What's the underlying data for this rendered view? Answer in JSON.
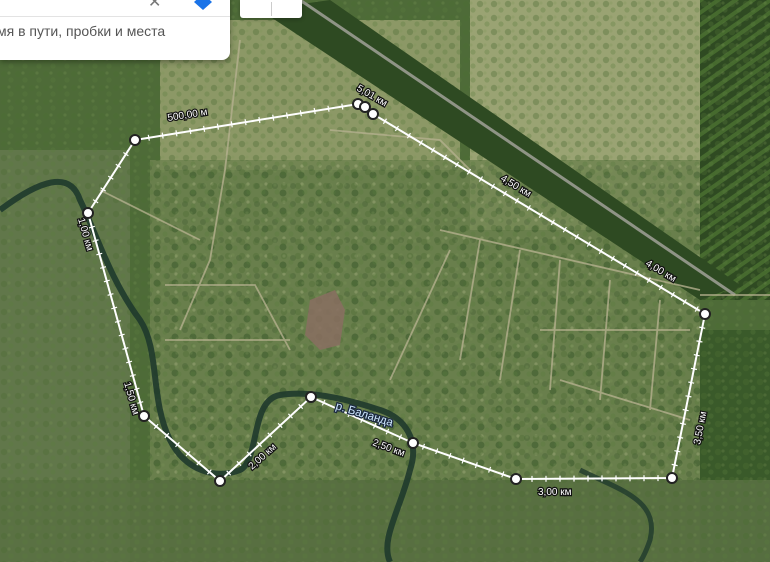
{
  "search_panel": {
    "clear_symbol": "✕",
    "traffic_text": "мя в пути, пробки и места"
  },
  "map": {
    "river_label": "р. Баланда",
    "measurement": {
      "line_color": "#ffffff",
      "segment_labels": [
        "500,00 м",
        "5,01 км",
        "4,50 км",
        "4,00 км",
        "3,50 км",
        "3,00 км",
        "2,50 км",
        "2,00 км",
        "1,50 км",
        "1,00 км"
      ]
    }
  }
}
